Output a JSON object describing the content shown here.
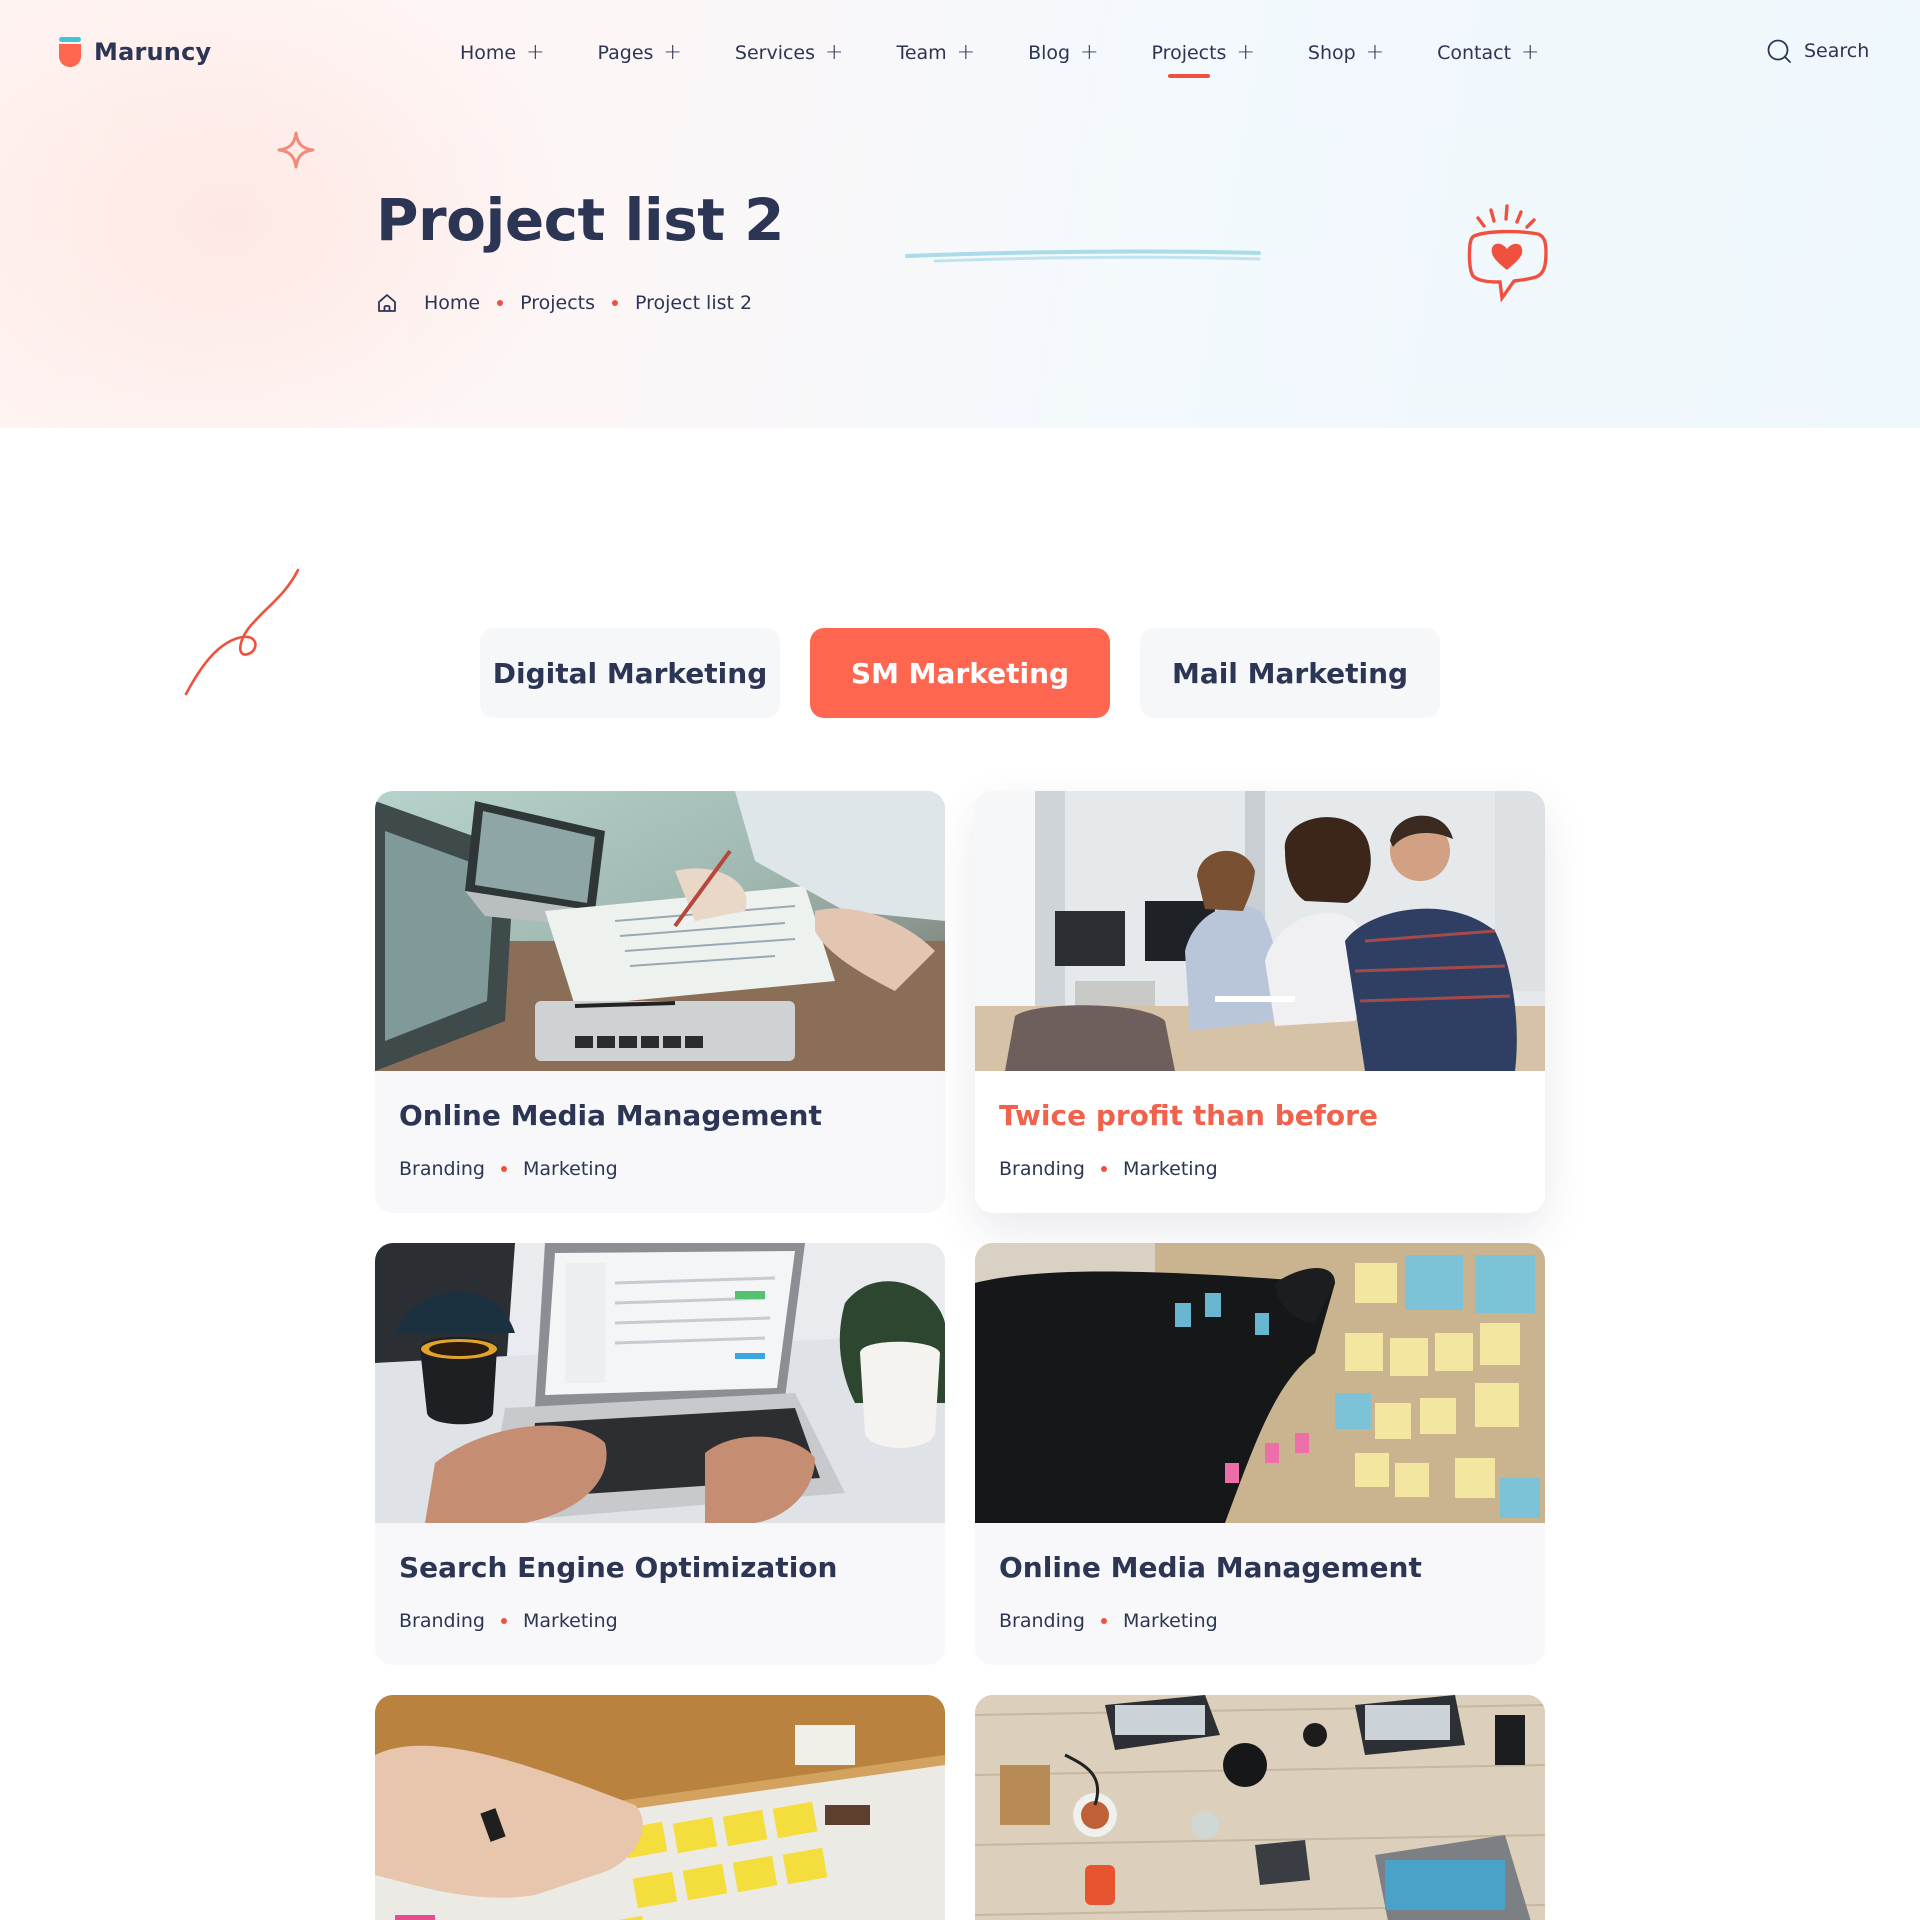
{
  "header": {
    "logo_text": "Maruncy",
    "nav": [
      {
        "label": "Home",
        "plus": "+"
      },
      {
        "label": "Pages",
        "plus": "+"
      },
      {
        "label": "Services",
        "plus": "+"
      },
      {
        "label": "Team",
        "plus": "+"
      },
      {
        "label": "Blog",
        "plus": "+"
      },
      {
        "label": "Projects",
        "plus": "+"
      },
      {
        "label": "Shop",
        "plus": "+"
      },
      {
        "label": "Contact",
        "plus": "+"
      }
    ],
    "active_nav": "Projects",
    "search_label": "Search"
  },
  "hero": {
    "title": "Project list 2",
    "breadcrumb": [
      "Home",
      "Projects",
      "Project list 2"
    ]
  },
  "tabs": [
    {
      "label": "Digital Marketing",
      "active": false
    },
    {
      "label": "SM Marketing",
      "active": true
    },
    {
      "label": "Mail Marketing",
      "active": false
    }
  ],
  "projects": [
    {
      "title": "Online Media Management",
      "tags": [
        "Branding",
        "Marketing"
      ]
    },
    {
      "title": "Twice profit than before",
      "tags": [
        "Branding",
        "Marketing"
      ],
      "highlighted": true
    },
    {
      "title": "Search Engine Optimization",
      "tags": [
        "Branding",
        "Marketing"
      ]
    },
    {
      "title": "Online Media Management",
      "tags": [
        "Branding",
        "Marketing"
      ]
    },
    {
      "title": "",
      "tags": []
    },
    {
      "title": "",
      "tags": []
    }
  ],
  "colors": {
    "accent": "#ff6650",
    "accent_text": "#f0624c",
    "text": "#2c3554",
    "tab_bg": "#f6f7f9",
    "card_bg": "#f8f8fa"
  },
  "icons": {
    "logo": "cup-logo-icon",
    "search": "search-icon",
    "home": "home-icon",
    "sparkle": "sparkle-icon",
    "heart_chat": "heart-chat-icon",
    "squiggle": "squiggle-decoration"
  }
}
